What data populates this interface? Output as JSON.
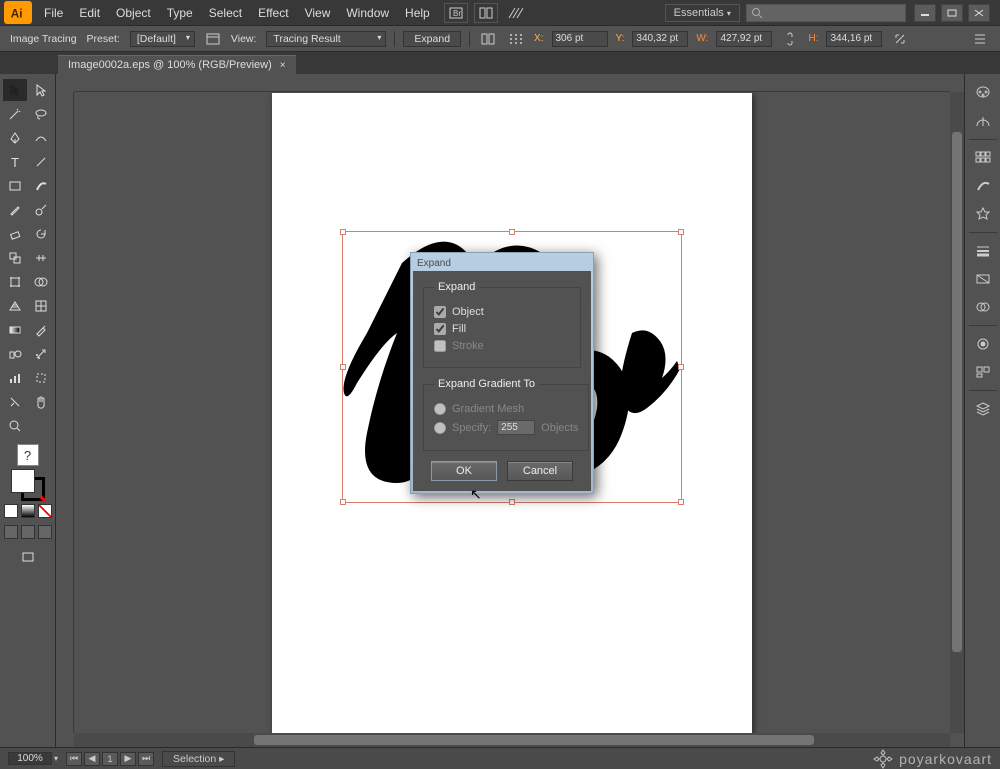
{
  "app": {
    "menus": [
      "File",
      "Edit",
      "Object",
      "Type",
      "Select",
      "Effect",
      "View",
      "Window",
      "Help"
    ],
    "workspace": "Essentials"
  },
  "control": {
    "label": "Image Tracing",
    "preset_label": "Preset:",
    "preset_value": "[Default]",
    "view_label": "View:",
    "view_value": "Tracing Result",
    "expand_button": "Expand",
    "x_label": "X:",
    "x_value": "306 pt",
    "y_label": "Y:",
    "y_value": "340,32 pt",
    "w_label": "W:",
    "w_value": "427,92 pt",
    "h_label": "H:",
    "h_value": "344,16 pt"
  },
  "tab": {
    "title": "Image0002a.eps @ 100% (RGB/Preview)"
  },
  "dialog": {
    "window_title": "Expand",
    "group1_title": "Expand",
    "object_label": "Object",
    "fill_label": "Fill",
    "stroke_label": "Stroke",
    "group2_title": "Expand Gradient To",
    "gradient_mesh_label": "Gradient Mesh",
    "specify_label": "Specify:",
    "specify_value": "255",
    "specify_unit": "Objects",
    "ok": "OK",
    "cancel": "Cancel"
  },
  "status": {
    "zoom": "100%",
    "info": "Selection"
  },
  "watermark": "poyarkovaart"
}
